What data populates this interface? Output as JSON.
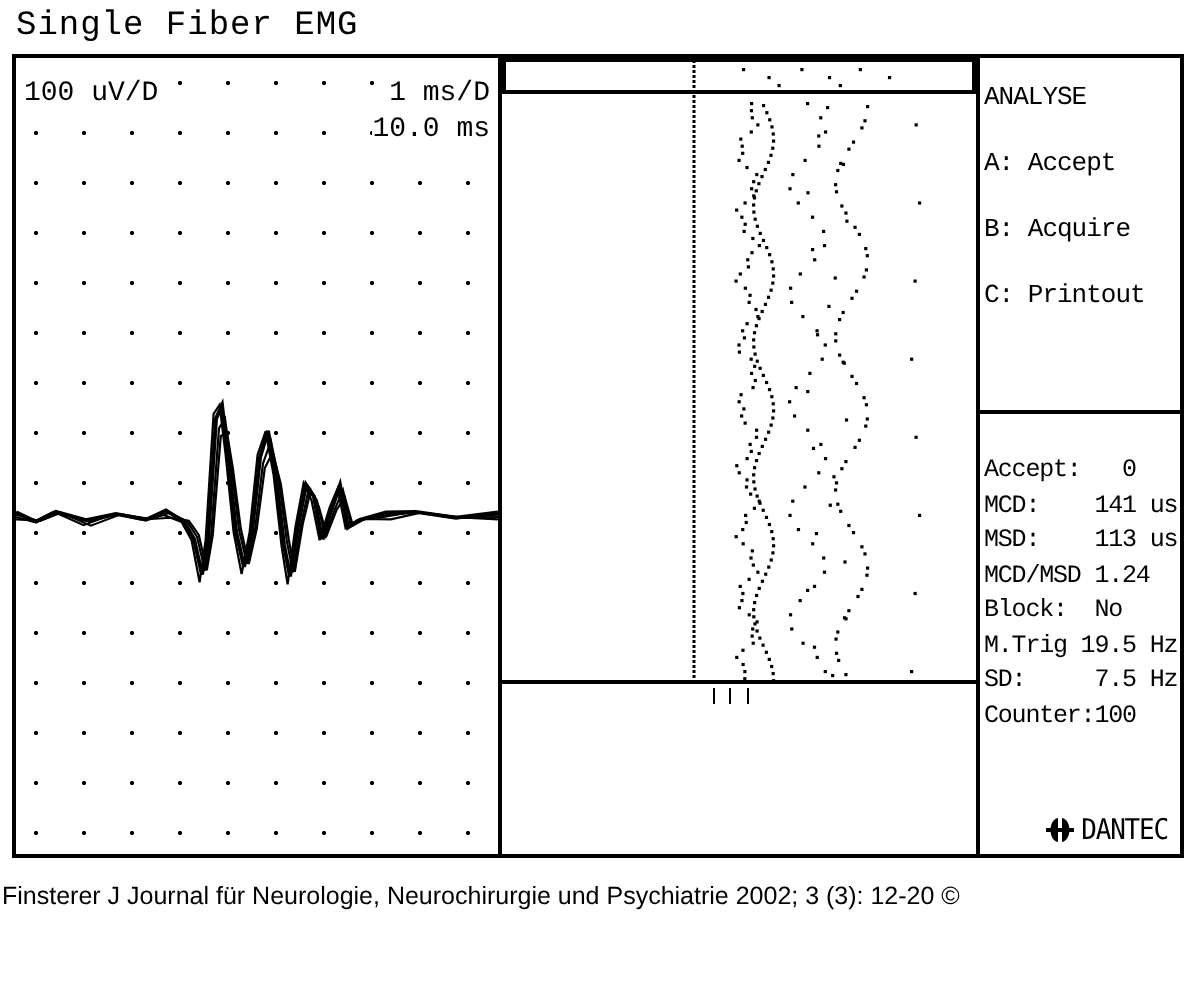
{
  "title": "Single Fiber EMG",
  "trace_panel": {
    "gain": "100 uV/D",
    "sweep": "1 ms/D",
    "delay": "10.0 ms"
  },
  "menu": {
    "heading": "ANALYSE",
    "options": [
      {
        "label": "A: Accept"
      },
      {
        "label": "B: Acquire"
      },
      {
        "label": "C: Printout"
      }
    ]
  },
  "results": [
    "Accept:   0",
    "MCD:    141 us",
    "MSD:    113 us",
    "MCD/MSD 1.24",
    "Block:  No",
    "M.Trig 19.5 Hz",
    "SD:     7.5 Hz",
    "Counter:100"
  ],
  "brand": "DANTEC",
  "caption": "Finsterer J Journal für Neurologie, Neurochirurgie und Psychiatrie 2002; 3 (3): 12-20 ©"
}
